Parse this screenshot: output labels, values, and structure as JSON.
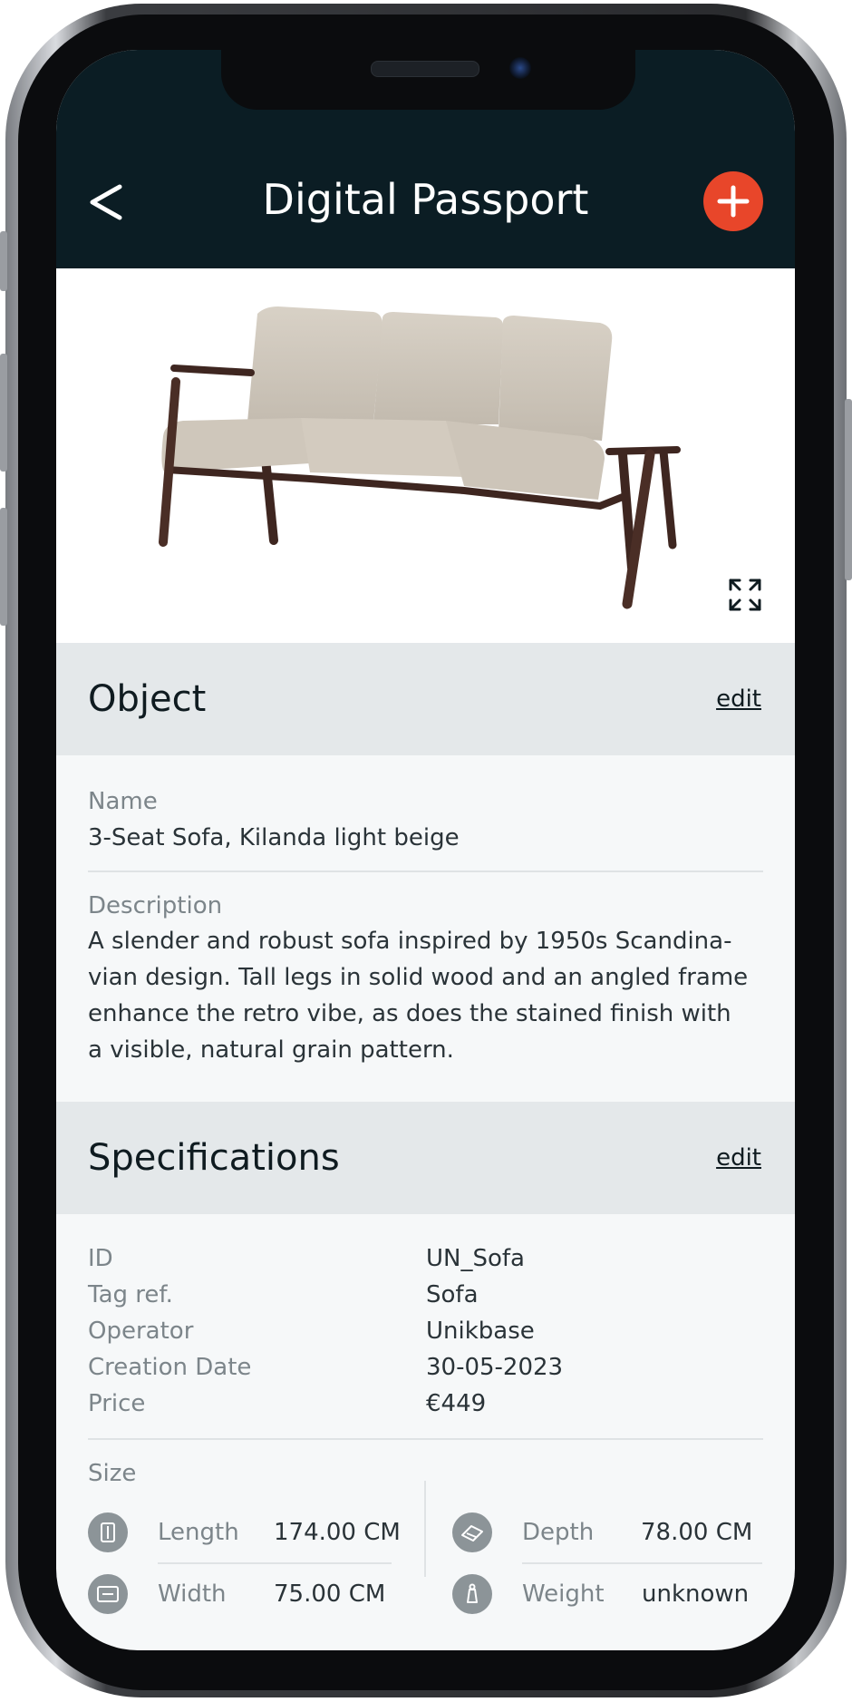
{
  "header": {
    "title": "Digital Passport",
    "back_icon": "chevron-left-icon",
    "add_icon": "plus-icon",
    "accent_color": "#e8462a",
    "bar_color": "#0b1d24"
  },
  "product_image": {
    "subject": "sofa-image",
    "expand_icon": "expand-icon"
  },
  "object_section": {
    "title": "Object",
    "edit_label": "edit",
    "name_label": "Name",
    "name_value": "3-Seat Sofa, Kilanda light beige",
    "description_label": "Description",
    "description_lines": [
      "A slender and robust sofa inspired by 1950s Scandina-",
      "vian design. Tall legs in solid wood and an angled frame",
      "enhance the retro vibe, as does the stained finish with",
      "a visible, natural grain pattern."
    ]
  },
  "specifications_section": {
    "title": "Specifications",
    "edit_label": "edit",
    "rows": [
      {
        "label": "ID",
        "value": "UN_Sofa"
      },
      {
        "label": "Tag ref.",
        "value": "Sofa"
      },
      {
        "label": "Operator",
        "value": "Unikbase"
      },
      {
        "label": "Creation Date",
        "value": "30-05-2023"
      },
      {
        "label": "Price",
        "value": "€449"
      }
    ],
    "size": {
      "label": "Size",
      "items": [
        {
          "label": "Length",
          "value": "174.00 CM",
          "icon": "length-icon"
        },
        {
          "label": "Depth",
          "value": "78.00 CM",
          "icon": "depth-icon"
        },
        {
          "label": "Width",
          "value": "75.00 CM",
          "icon": "width-icon"
        },
        {
          "label": "Weight",
          "value": "unknown",
          "icon": "weight-icon"
        }
      ]
    }
  }
}
